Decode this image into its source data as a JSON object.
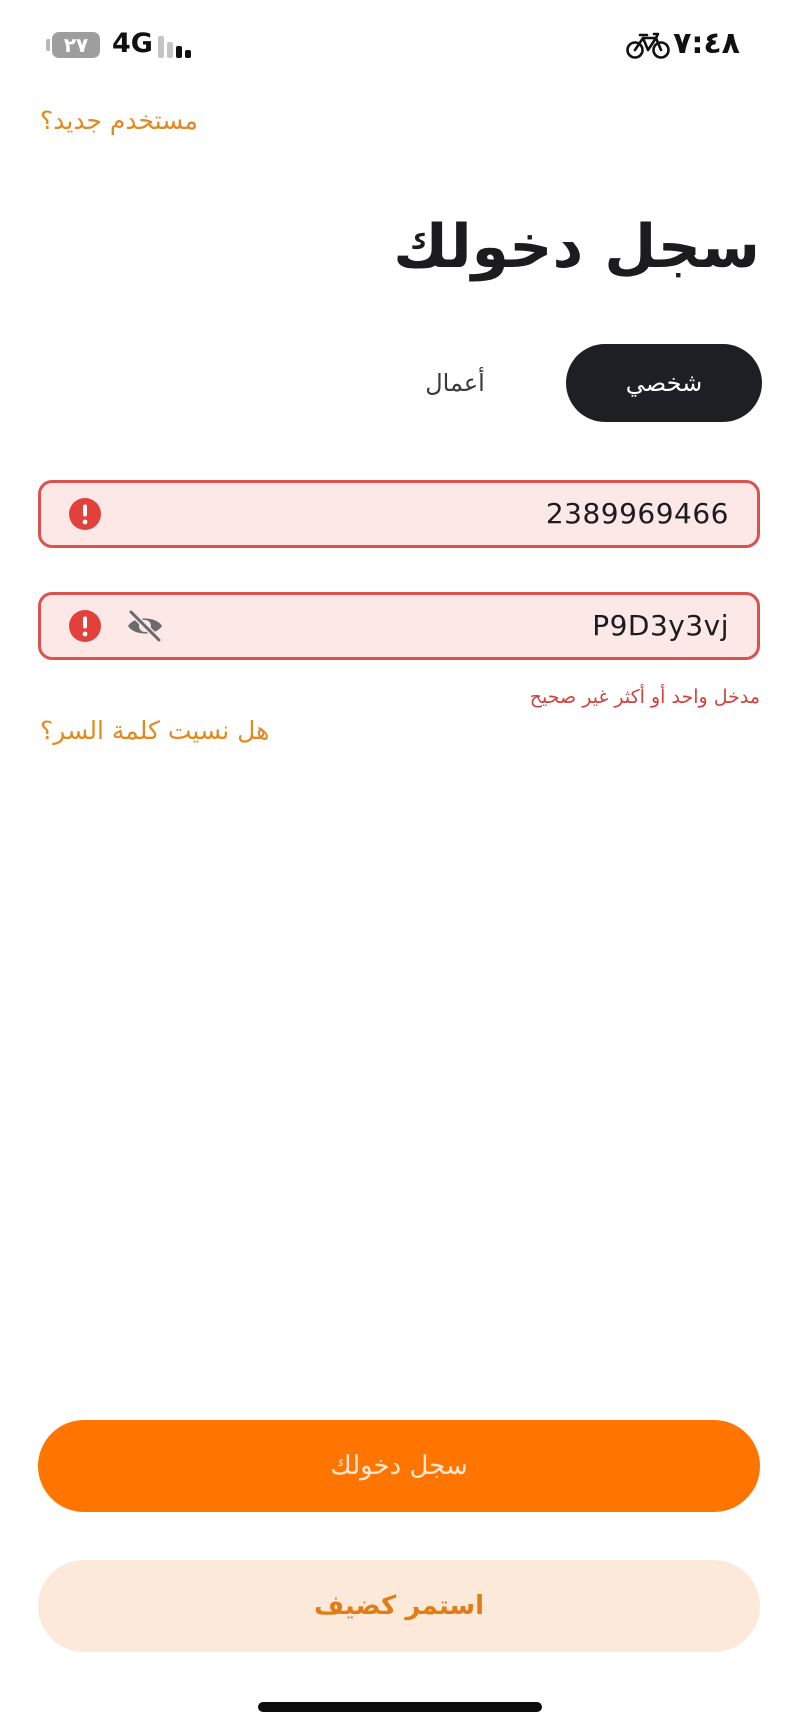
{
  "status_bar": {
    "battery": "٢٧",
    "network": "4G",
    "time": "٧:٤٨"
  },
  "header": {
    "new_user_link": "مستخدم جديد؟",
    "title": "سجل دخولك"
  },
  "tabs": {
    "personal": "شخصي",
    "business": "أعمال",
    "selected": "personal"
  },
  "form": {
    "phone_value": "2389969466",
    "password_value": "P9D3y3vj",
    "error_message": "مدخل واحد أو أكثر غير صحيح",
    "forgot_password_link": "هل نسيت كلمة السر؟"
  },
  "actions": {
    "login_button": "سجل دخولك",
    "guest_button": "استمر كضيف"
  },
  "colors": {
    "accent": "#ff7500",
    "error": "#d9534f",
    "link": "#e08a22",
    "dark": "#1e1f24"
  }
}
